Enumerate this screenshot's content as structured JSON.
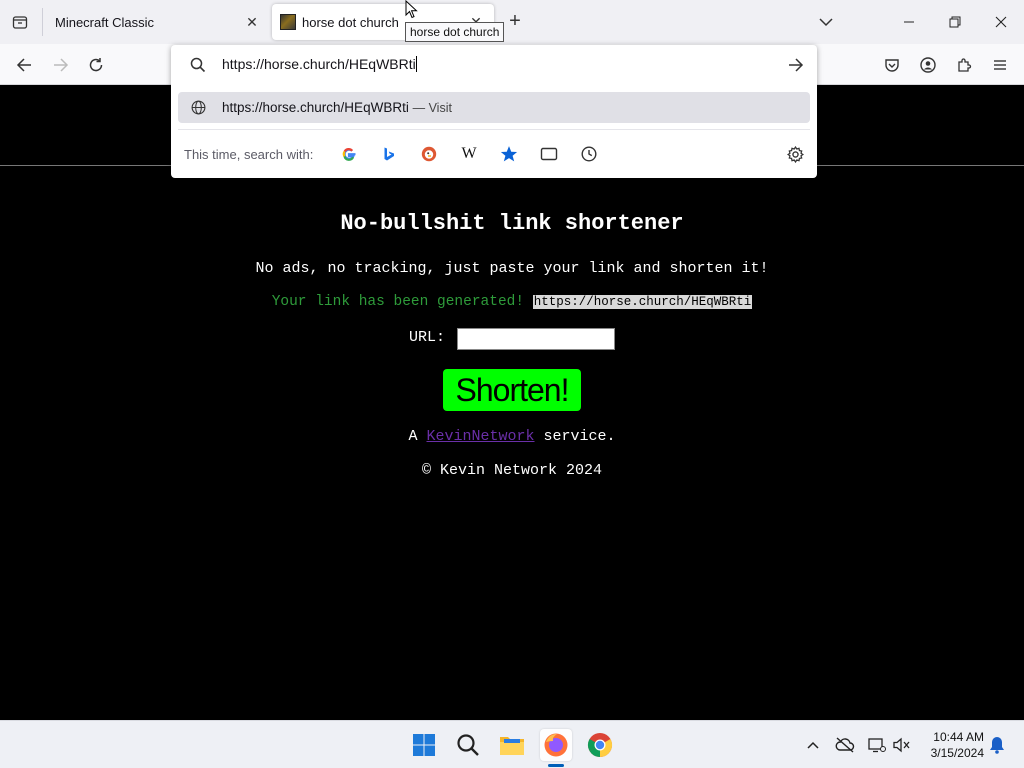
{
  "browser": {
    "tabs": [
      {
        "title": "Minecraft Classic",
        "active": false
      },
      {
        "title": "horse dot church",
        "active": true
      }
    ],
    "tooltip": "horse dot church",
    "urlbar": {
      "value": "https://horse.church/HEqWBRti",
      "result_url": "https://horse.church/HEqWBRti",
      "result_action": "— Visit",
      "search_with_label": "This time, search with:",
      "engines": [
        "google-icon",
        "bing-icon",
        "duckduckgo-icon",
        "wikipedia-icon",
        "bookmarks-icon",
        "tabs-icon",
        "history-icon"
      ]
    }
  },
  "page": {
    "heading": "No-bullshit link shortener",
    "tagline": "No ads, no tracking, just paste your link and shorten it!",
    "generated_text": "Your link has been generated!",
    "generated_link": "https://horse.church/HEqWBRti",
    "url_label": "URL:",
    "url_input_value": "",
    "shorten_button": "Shorten!",
    "service_prefix": "A",
    "service_link": "KevinNetwork",
    "service_suffix": "service.",
    "copyright": "© Kevin Network 2024",
    "colors": {
      "background": "#000000",
      "success_text": "#2e9b3a",
      "button": "#00ff00",
      "link": "#6a2fa8"
    }
  },
  "taskbar": {
    "time": "10:44 AM",
    "date": "3/15/2024"
  }
}
